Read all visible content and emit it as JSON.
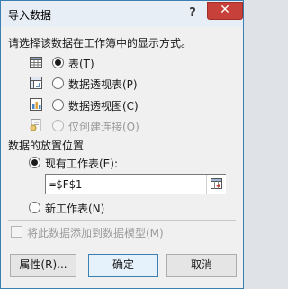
{
  "window": {
    "title": "导入数据",
    "help_label": "?",
    "close_label": "✕"
  },
  "section1": {
    "header": "请选择该数据在工作簿中的显示方式。"
  },
  "display_options": [
    {
      "label": "表(T)",
      "icon": "table-icon",
      "checked": true,
      "disabled": false
    },
    {
      "label": "数据透视表(P)",
      "icon": "pivot-table-icon",
      "checked": false,
      "disabled": false
    },
    {
      "label": "数据透视图(C)",
      "icon": "pivot-chart-icon",
      "checked": false,
      "disabled": false
    },
    {
      "label": "仅创建连接(O)",
      "icon": "connection-icon",
      "checked": false,
      "disabled": true
    }
  ],
  "section2": {
    "header": "数据的放置位置"
  },
  "placement": {
    "existing_label": "现有工作表(E):",
    "existing_checked": true,
    "cell_value": "=$F$1",
    "new_label": "新工作表(N)",
    "new_checked": false
  },
  "data_model": {
    "label": "将此数据添加到数据模型(M)",
    "checked": false,
    "disabled": true
  },
  "buttons": {
    "properties": "属性(R)...",
    "ok": "确定",
    "cancel": "取消"
  },
  "colors": {
    "accent": "#3c7fb1",
    "close": "#c7403a"
  }
}
